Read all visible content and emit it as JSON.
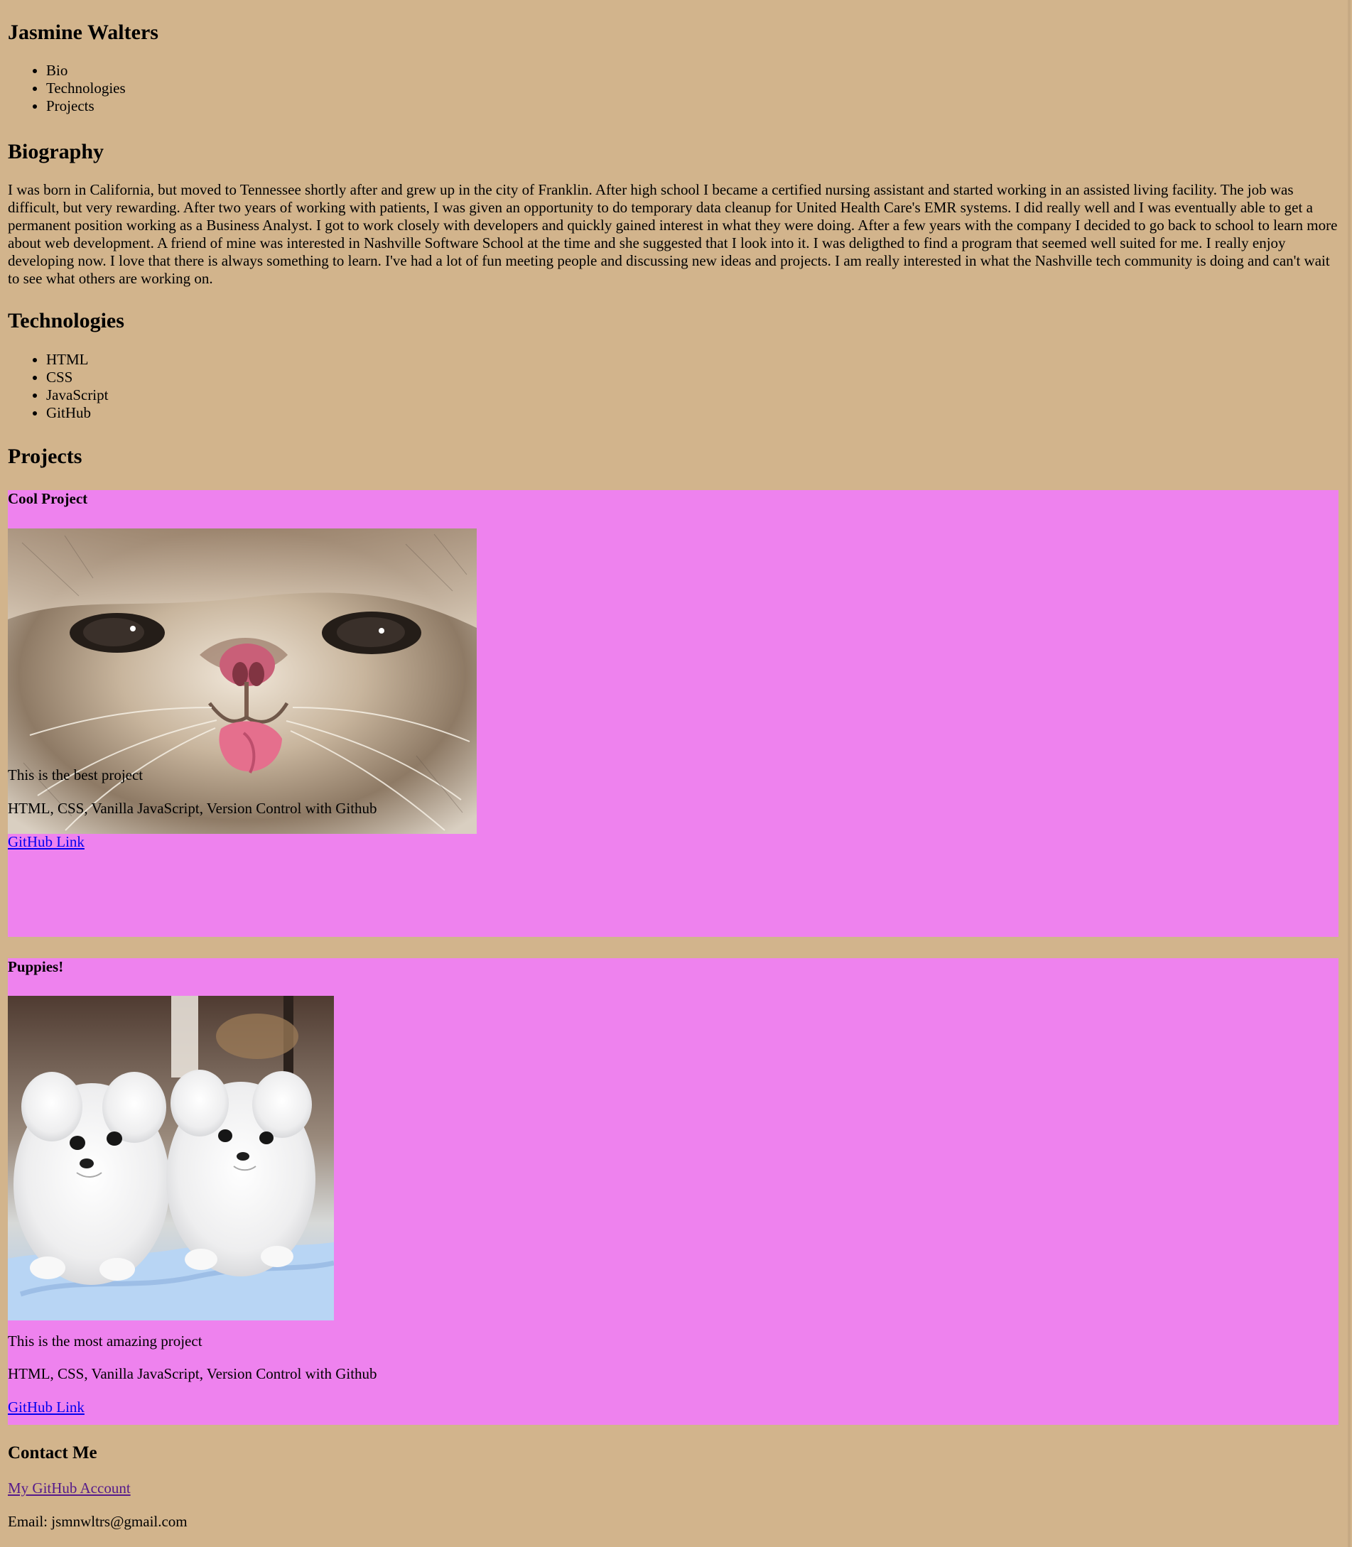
{
  "header": {
    "name": "Jasmine Walters"
  },
  "nav": {
    "items": [
      {
        "label": "Bio"
      },
      {
        "label": "Technologies"
      },
      {
        "label": "Projects"
      }
    ]
  },
  "biography": {
    "heading": "Biography",
    "text": "I was born in California, but moved to Tennessee shortly after and grew up in the city of Franklin. After high school I became a certified nursing assistant and started working in an assisted living facility. The job was difficult, but very rewarding. After two years of working with patients, I was given an opportunity to do temporary data cleanup for United Health Care's EMR systems. I did really well and I was eventually able to get a permanent position working as a Business Analyst. I got to work closely with developers and quickly gained interest in what they were doing. After a few years with the company I decided to go back to school to learn more about web development. A friend of mine was interested in Nashville Software School at the time and she suggested that I look into it. I was deligthed to find a program that seemed well suited for me. I really enjoy developing now. I love that there is always something to learn. I've had a lot of fun meeting people and discussing new ideas and projects. I am really interested in what the Nashville tech community is doing and can't wait to see what others are working on."
  },
  "technologies": {
    "heading": "Technologies",
    "items": [
      {
        "label": "HTML"
      },
      {
        "label": "CSS"
      },
      {
        "label": "JavaScript"
      },
      {
        "label": "GitHub"
      }
    ]
  },
  "projects": {
    "heading": "Projects",
    "items": [
      {
        "title": "Cool Project",
        "image_subject": "cat-photo",
        "description": "This is the best project",
        "tech": "HTML, CSS, Vanilla JavaScript, Version Control with Github",
        "link_label": "GitHub Link"
      },
      {
        "title": "Puppies!",
        "image_subject": "puppies-photo",
        "description": "This is the most amazing project",
        "tech": "HTML, CSS, Vanilla JavaScript, Version Control with Github",
        "link_label": "GitHub Link"
      }
    ]
  },
  "contact": {
    "heading": "Contact Me",
    "github_label": "My GitHub Account",
    "email_text": "Email: jsmnwltrs@gmail.com"
  },
  "colors": {
    "page_background": "#d2b48c",
    "project_card_background": "#ee82ee",
    "link": "#0000ee",
    "visited_link": "#551a8b"
  }
}
